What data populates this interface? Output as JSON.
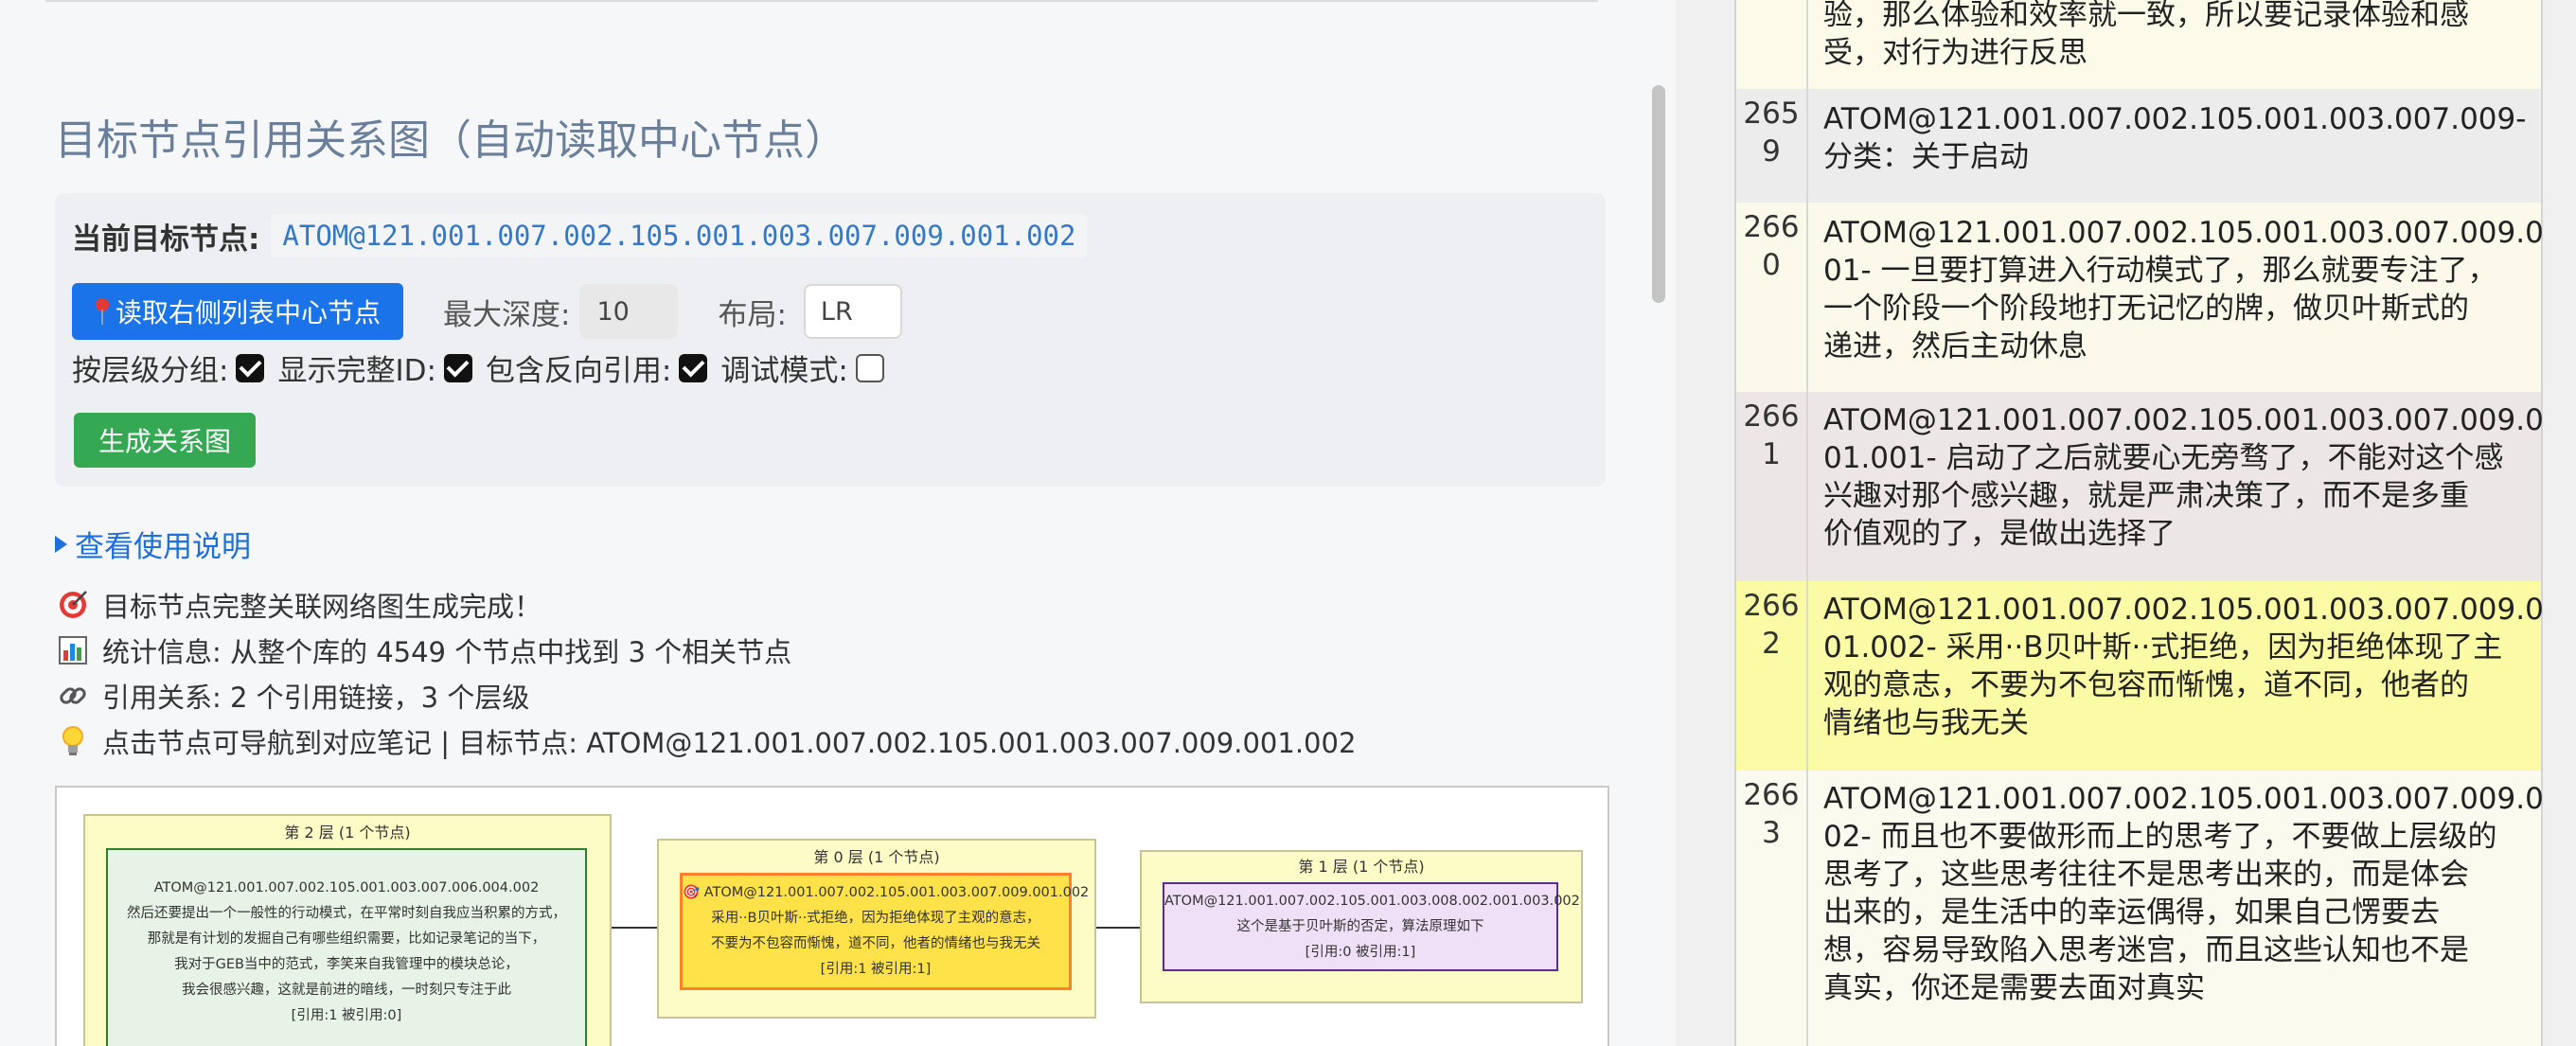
{
  "page_title": "目标节点引用关系图（自动读取中心节点）",
  "current_target": {
    "label": "当前目标节点:",
    "value": "ATOM@121.001.007.002.105.001.003.007.009.001.002"
  },
  "controls": {
    "read_button_label": "读取右侧列表中心节点",
    "max_depth_label": "最大深度:",
    "max_depth_value": "10",
    "layout_label": "布局:",
    "layout_value": "LR",
    "group_by_level_label": "按层级分组:",
    "group_by_level_checked": true,
    "show_full_id_label": "显示完整ID:",
    "show_full_id_checked": true,
    "include_reverse_label": "包含反向引用:",
    "include_reverse_checked": true,
    "debug_mode_label": "调试模式:",
    "debug_mode_checked": false,
    "generate_button_label": "生成关系图"
  },
  "usage_toggle_label": "查看使用说明",
  "info": {
    "complete": "目标节点完整关联网络图生成完成！",
    "stats": "统计信息: 从整个库的 4549 个节点中找到 3 个相关节点",
    "references": "引用关系: 2 个引用链接，3 个层级",
    "hint": "点击节点可导航到对应笔记 | 目标节点: ATOM@121.001.007.002.105.001.003.007.009.001.002"
  },
  "graph": {
    "layers": [
      {
        "title": "第 2 层 (1 个节点)",
        "node": {
          "lines": [
            "ATOM@121.001.007.002.105.001.003.007.006.004.002",
            "然后还要提出一个一般性的行动模式，在平常时刻自我应当积累的方式，",
            "那就是有计划的发掘自己有哪些组织需要，比如记录笔记的当下，",
            "我对于GEB当中的范式，李笑来自我管理中的模块总论，",
            "我会很感兴趣，这就是前进的暗线，一时刻只专注于此",
            "[引用:1 被引用:0]"
          ]
        }
      },
      {
        "title": "第 0 层 (1 个节点)",
        "node": {
          "target_icon": "🎯",
          "lines": [
            "ATOM@121.001.007.002.105.001.003.007.009.001.002",
            "采用··B贝叶斯··式拒绝，因为拒绝体现了主观的意志，",
            "不要为不包容而惭愧，道不同，他者的情绪也与我无关",
            "[引用:1 被引用:1]"
          ]
        }
      },
      {
        "title": "第 1 层 (1 个节点)",
        "node": {
          "lines": [
            "ATOM@121.001.007.002.105.001.003.008.002.001.003.002",
            "这个是基于贝叶斯的否定，算法原理如下",
            "[引用:0 被引用:1]"
          ]
        }
      }
    ]
  },
  "right_table": {
    "rows": [
      {
        "num_lines": [],
        "text_lines": [
          "验，那么体验和效率就一致，所以要记录体验和感",
          "受，对行为进行反思"
        ]
      },
      {
        "num_lines": [
          "265",
          "9"
        ],
        "text_lines": [
          "ATOM@121.001.007.002.105.001.003.007.009-",
          "分类：关于启动"
        ]
      },
      {
        "num_lines": [
          "266",
          "0"
        ],
        "text_lines": [
          "ATOM@121.001.007.002.105.001.003.007.009.0",
          "01- 一旦要打算进入行动模式了，那么就要专注了，",
          "一个阶段一个阶段地打无记忆的牌，做贝叶斯式的",
          "递进，然后主动休息"
        ]
      },
      {
        "num_lines": [
          "266",
          "1"
        ],
        "text_lines": [
          "ATOM@121.001.007.002.105.001.003.007.009.0",
          "01.001- 启动了之后就要心无旁骛了，不能对这个感",
          "兴趣对那个感兴趣，就是严肃决策了，而不是多重",
          "价值观的了，是做出选择了"
        ]
      },
      {
        "num_lines": [
          "266",
          "2"
        ],
        "text_lines": [
          "ATOM@121.001.007.002.105.001.003.007.009.0",
          "01.002- 采用··B贝叶斯··式拒绝，因为拒绝体现了主",
          "观的意志，不要为不包容而惭愧，道不同，他者的",
          "情绪也与我无关"
        ]
      },
      {
        "num_lines": [
          "266",
          "3"
        ],
        "text_lines": [
          "ATOM@121.001.007.002.105.001.003.007.009.0",
          "02- 而且也不要做形而上的思考了，不要做上层级的",
          "思考了，这些思考往往不是思考出来的，而是体会",
          "出来的，是生活中的幸运偶得，如果自己愣要去",
          "想，容易导致陷入思考迷宫，而且这些认知也不是",
          "真实，你还是需要去面对真实"
        ]
      }
    ]
  },
  "colors": {
    "accent_blue": "#1a73e8",
    "accent_green": "#34a853",
    "layer_bg": "#fdfbc6",
    "node_context_bg": "#e6f3e6",
    "node_target_bg": "#ffe14a",
    "node_target_border": "#ff7f2a",
    "node_ref_bg": "#efe0f7",
    "node_ref_border": "#5b2d8c",
    "row_highlight": "#fbfba6"
  }
}
